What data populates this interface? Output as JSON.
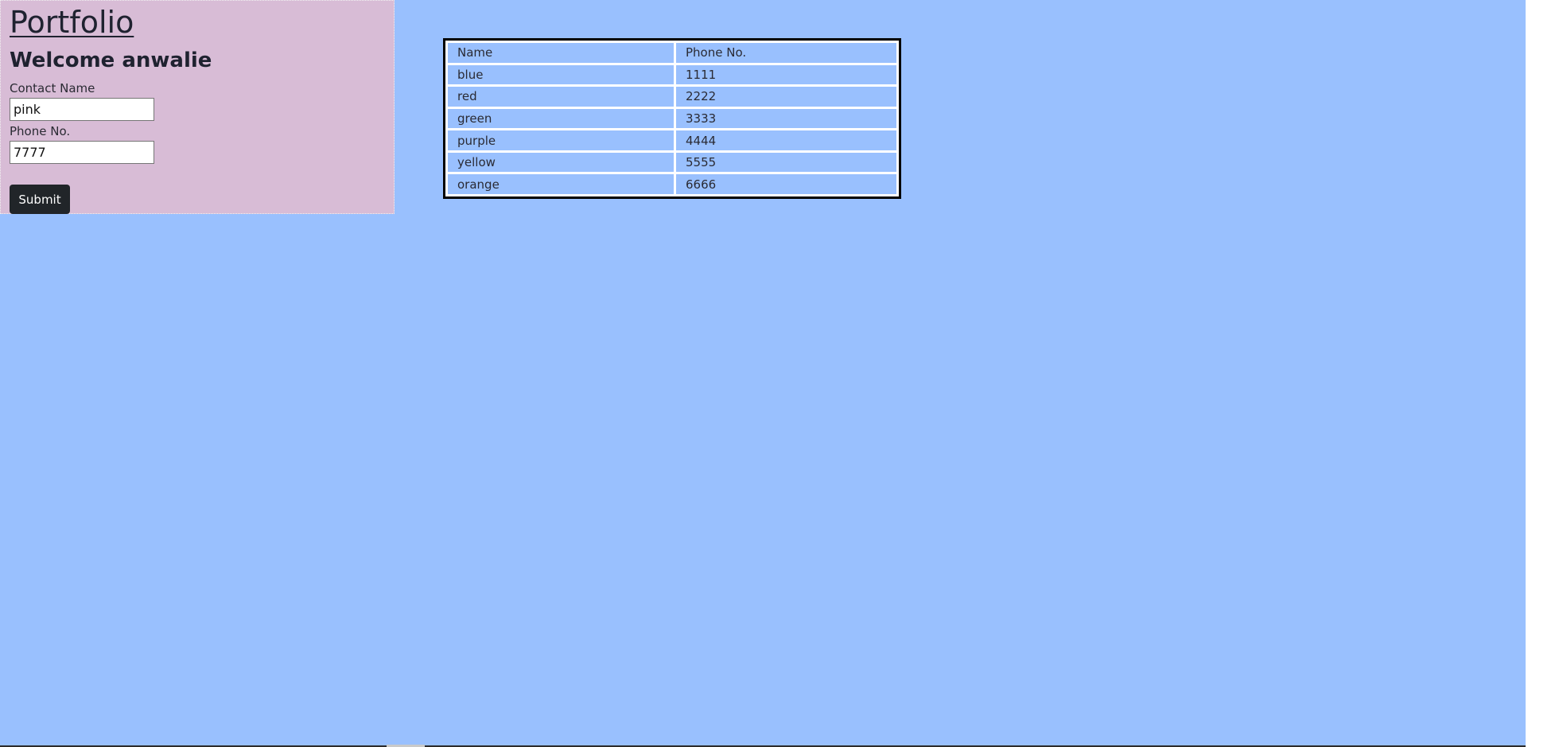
{
  "page": {
    "title": "Portfolio",
    "welcome": "Welcome anwalie",
    "colors": {
      "page_background": "#99c0fe",
      "form_panel_background": "#d8bcd6",
      "button_background": "#212529"
    }
  },
  "form": {
    "contact_name_label": "Contact Name",
    "contact_name_value": "pink",
    "phone_label": "Phone No.",
    "phone_value": "7777",
    "submit_label": "Submit"
  },
  "table": {
    "headers": [
      "Name",
      "Phone No."
    ],
    "rows": [
      {
        "name": "blue",
        "phone": "1111"
      },
      {
        "name": "red",
        "phone": "2222"
      },
      {
        "name": "green",
        "phone": "3333"
      },
      {
        "name": "purple",
        "phone": "4444"
      },
      {
        "name": "yellow",
        "phone": "5555"
      },
      {
        "name": "orange",
        "phone": "6666"
      }
    ]
  }
}
